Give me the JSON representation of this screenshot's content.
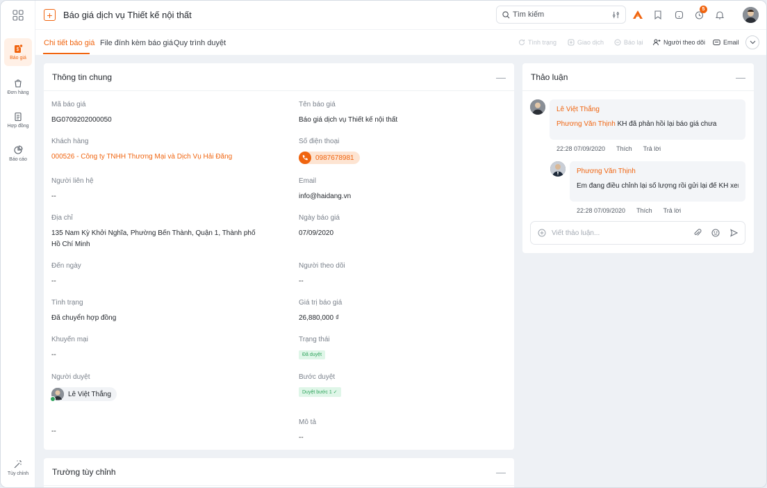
{
  "sidebar": {
    "items": [
      {
        "label": "Báo giá",
        "icon": "quote-icon",
        "active": true
      },
      {
        "label": "Đơn hàng",
        "icon": "order-icon"
      },
      {
        "label": "Hợp đồng",
        "icon": "contract-icon"
      },
      {
        "label": "Báo cáo",
        "icon": "report-icon"
      }
    ],
    "bottom": {
      "label": "Tùy chỉnh",
      "icon": "magic-wand-icon"
    }
  },
  "header": {
    "title": "Báo giá dịch vụ Thiết kế nội thất",
    "search_placeholder": "Tìm kiếm",
    "notification_count": "5"
  },
  "tabs": [
    {
      "label": "Chi tiết báo giá",
      "active": true
    },
    {
      "label": "File đính kèm báo giá"
    },
    {
      "label": "Quy trình duyệt"
    }
  ],
  "actions": {
    "status": "Tình trạng",
    "transaction": "Giao dịch",
    "report": "Báo lại",
    "follower": "Người theo dõi",
    "email": "Email"
  },
  "general": {
    "title": "Thông tin chung",
    "fields": {
      "code_label": "Mã báo giá",
      "code_value": "BG0709202000050",
      "name_label": "Tên báo giá",
      "name_value": "Báo giá dịch vụ Thiết kế nội thất",
      "customer_label": "Khách hàng",
      "customer_value": "000526 - Công ty TNHH Thương Mại và Dịch Vụ Hải Đăng",
      "phone_label": "Số điện thoại",
      "phone_value": "0987678981",
      "contact_label": "Người liên hệ",
      "contact_value": "--",
      "email_label": "Email",
      "email_value": "info@haidang.vn",
      "address_label": "Địa chỉ",
      "address_value": "135 Nam Kỳ Khởi Nghĩa, Phường Bến Thành, Quận 1, Thành phố Hồ Chí Minh",
      "quote_date_label": "Ngày báo giá",
      "quote_date_value": "07/09/2020",
      "to_date_label": "Đến ngày",
      "to_date_value": "--",
      "follower_label": "Người theo dõi",
      "follower_value": "--",
      "condition_label": "Tình trạng",
      "condition_value": "Đã chuyển hợp đồng",
      "amount_label": "Giá trị báo giá",
      "amount_value": "26,880,000 ₫",
      "promo_label": "Khuyến mại",
      "promo_value": "--",
      "state_label": "Trạng thái",
      "state_value": "Đã duyệt",
      "approver_label": "Người duyệt",
      "approver_value": "Lê Việt Thắng",
      "step_label": "Bước duyệt",
      "step_value": "Duyệt bước 1 ✓",
      "extra_value": "--",
      "desc_label": "Mô tả",
      "desc_value": "--"
    }
  },
  "custom": {
    "title": "Trường tùy chỉnh"
  },
  "discussion": {
    "title": "Thảo luận",
    "comments": [
      {
        "name": "Lê Việt Thắng",
        "mention": "Phương Văn Thịnh",
        "text": " KH đã phản hồi lại báo giá chưa",
        "time": "22:28 07/09/2020",
        "like": "Thích",
        "reply": "Trả lời"
      },
      {
        "name": "Phương Văn Thịnh",
        "text": "Em đang điều chỉnh lại số lượng rồi gửi lại để KH xem ạ",
        "time": "22:28 07/09/2020",
        "like": "Thích",
        "reply": "Trả lời"
      }
    ],
    "composer_placeholder": "Viết thảo luận..."
  },
  "colors": {
    "accent": "#f0640f",
    "success": "#2fa35c"
  }
}
